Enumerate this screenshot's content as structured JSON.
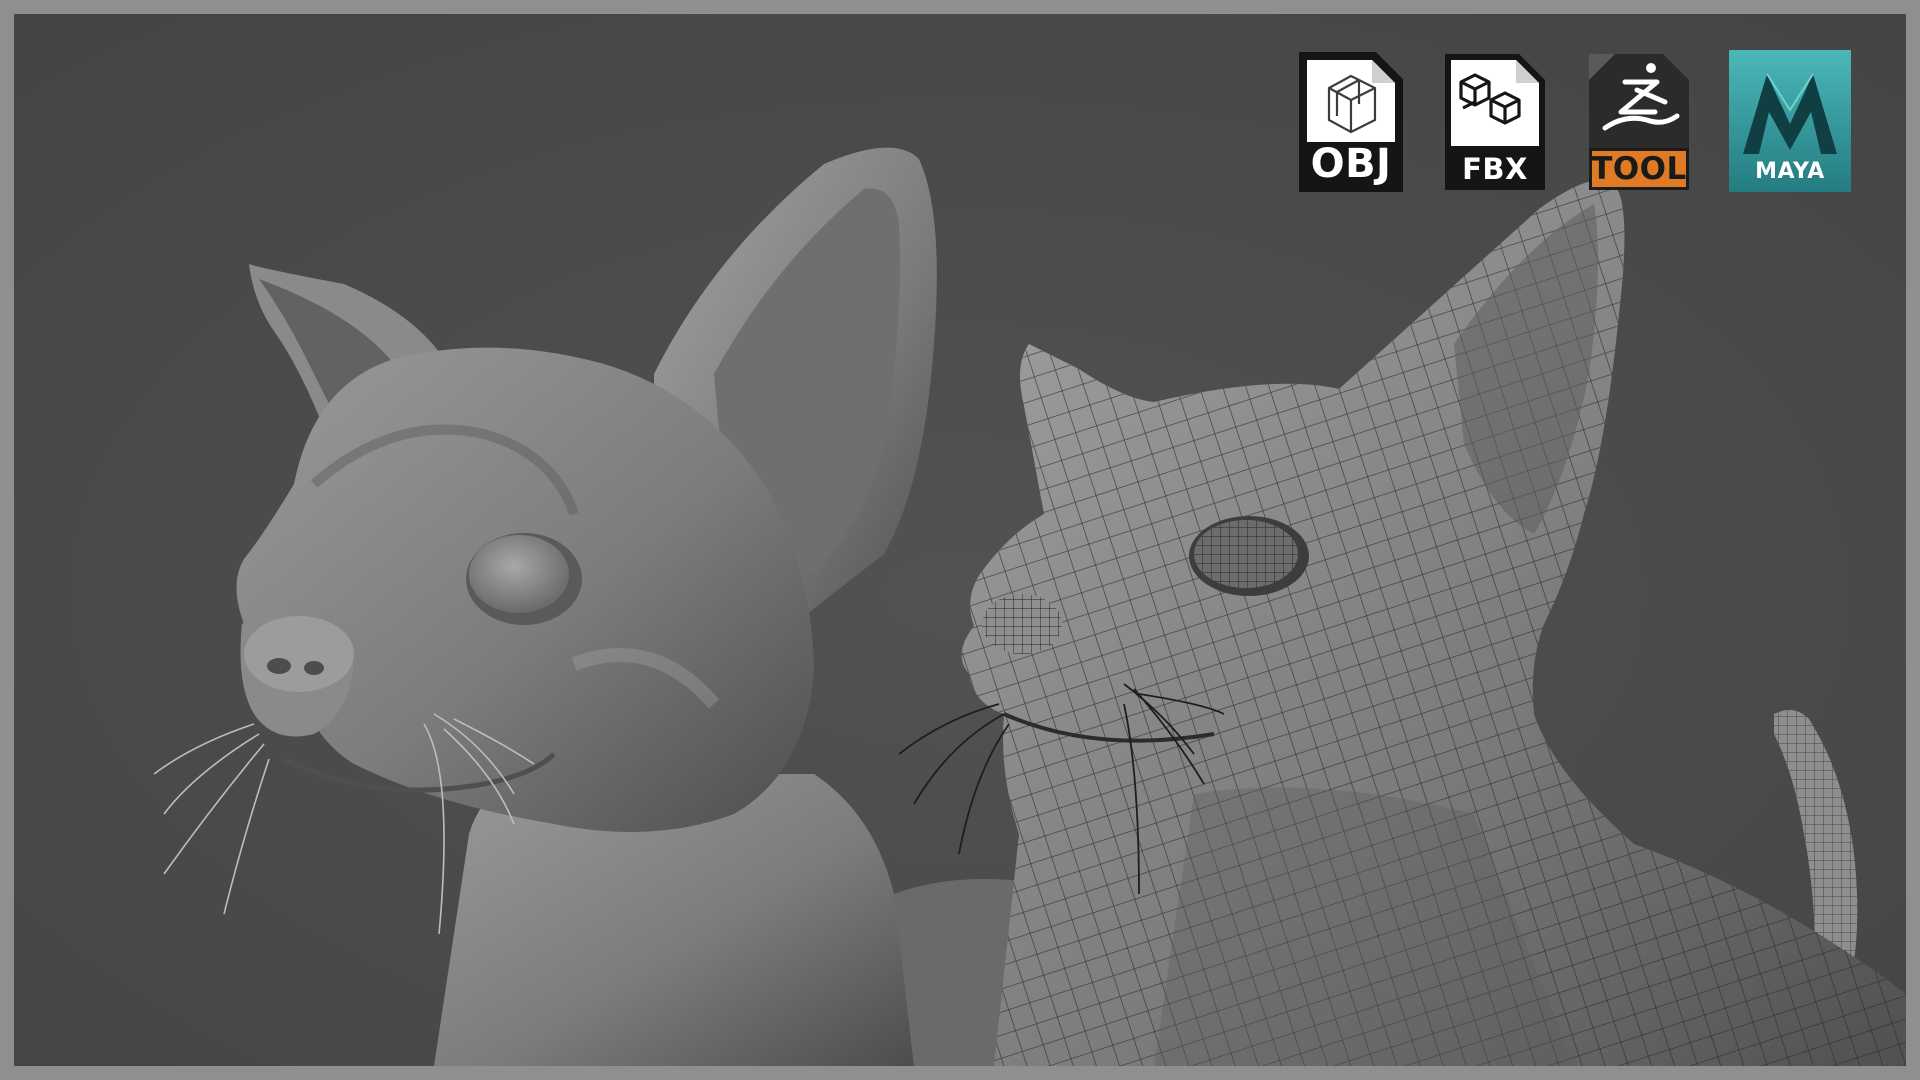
{
  "badges": {
    "obj": {
      "label": "OBJ"
    },
    "fbx": {
      "label": "FBX"
    },
    "tool": {
      "label": "TOOL"
    },
    "maya": {
      "label": "MAYA"
    }
  },
  "icons": {
    "obj": "cube-wireframe-icon",
    "fbx": "three-cubes-icon",
    "tool": "zbrush-runner-icon",
    "maya": "maya-m-logo-icon"
  },
  "colors": {
    "background": "#4a4a4a",
    "border": "#8f8f8f",
    "tool_band": "#e07a24",
    "maya_teal": "#3aa9ad"
  }
}
